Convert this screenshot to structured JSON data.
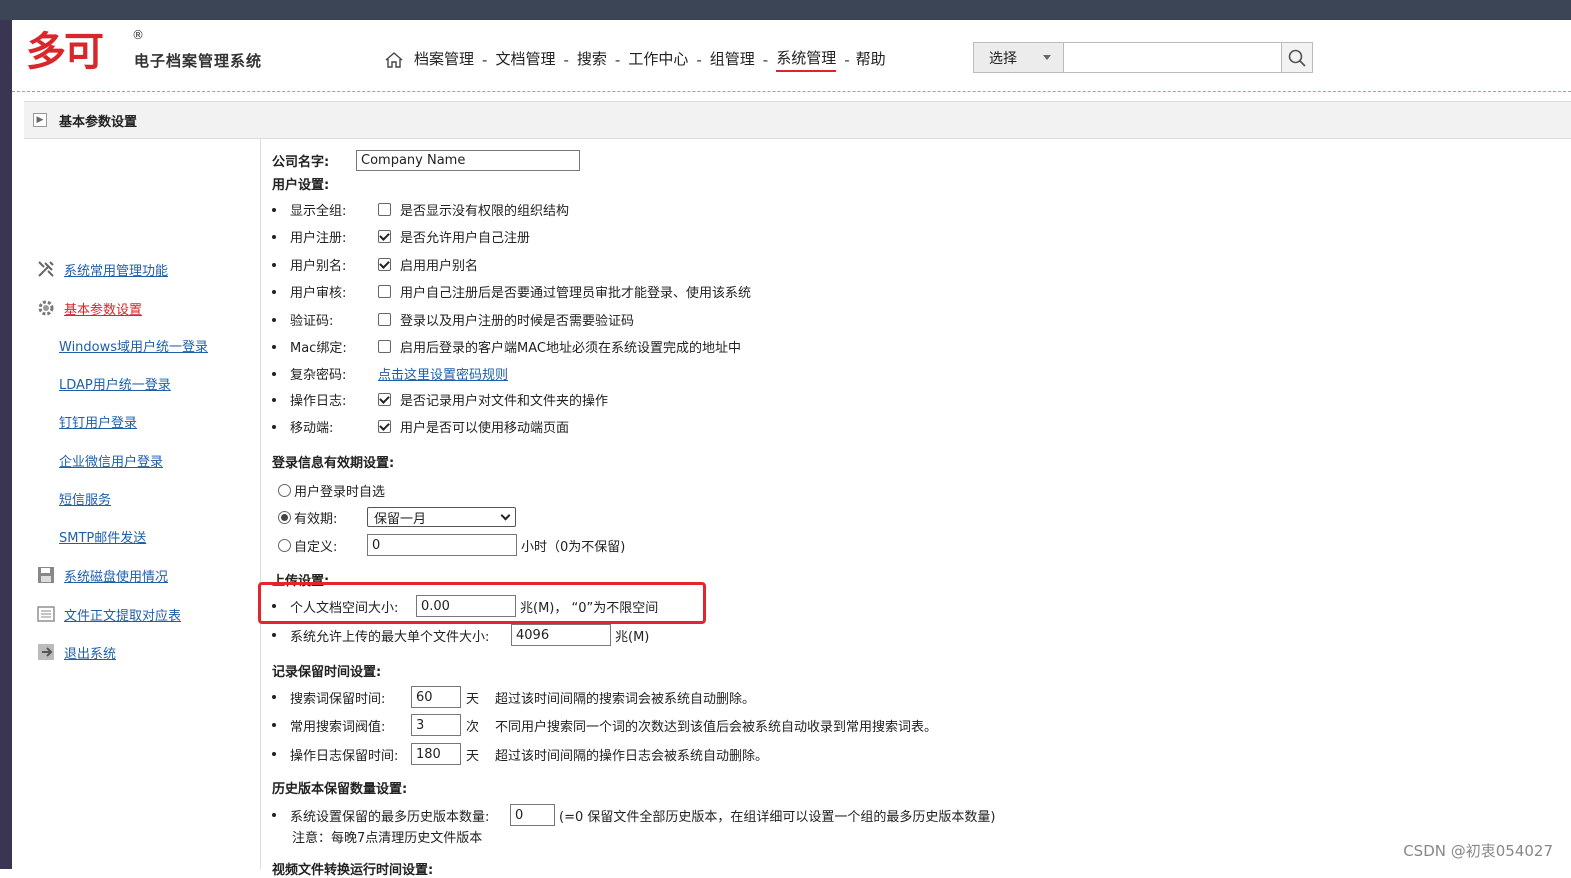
{
  "header": {
    "logo_text": "多可",
    "logo_sub": "电子档案管理系统",
    "reg_mark": "®"
  },
  "nav": {
    "items": [
      {
        "label": "档案管理"
      },
      {
        "label": "文档管理"
      },
      {
        "label": "搜索"
      },
      {
        "label": "工作中心"
      },
      {
        "label": "组管理"
      },
      {
        "label": "系统管理",
        "active": true
      },
      {
        "label": "帮助"
      }
    ],
    "sep": "-"
  },
  "search": {
    "select_label": "选择",
    "placeholder": ""
  },
  "title": "基本参数设置",
  "sidebar": {
    "items": [
      {
        "label": "系统常用管理功能",
        "icon": "tools-icon"
      },
      {
        "label": "基本参数设置",
        "icon": "gear-icon",
        "active": true
      },
      {
        "label": "Windows域用户统一登录"
      },
      {
        "label": "LDAP用户统一登录"
      },
      {
        "label": "钉钉用户登录"
      },
      {
        "label": "企业微信用户登录"
      },
      {
        "label": "短信服务"
      },
      {
        "label": "SMTP邮件发送"
      },
      {
        "label": "系统磁盘使用情况",
        "icon": "disk-icon"
      },
      {
        "label": "文件正文提取对应表",
        "icon": "list-icon"
      },
      {
        "label": "退出系统",
        "icon": "exit-icon"
      }
    ]
  },
  "form": {
    "company_label": "公司名字:",
    "company_value": "Company Name",
    "user_settings": "用户设置:",
    "user_rows": [
      {
        "label": "显示全组:",
        "checked": false,
        "text": "是否显示没有权限的组织结构"
      },
      {
        "label": "用户注册:",
        "checked": true,
        "text": "是否允许用户自己注册"
      },
      {
        "label": "用户别名:",
        "checked": true,
        "text": "启用用户别名"
      },
      {
        "label": "用户审核:",
        "checked": false,
        "text": "用户自己注册后是否要通过管理员审批才能登录、使用该系统"
      },
      {
        "label": "验证码:",
        "checked": false,
        "text": "登录以及用户注册的时候是否需要验证码"
      },
      {
        "label": "Mac绑定:",
        "checked": false,
        "text": "启用后登录的客户端MAC地址必须在系统设置完成的地址中"
      },
      {
        "label": "复杂密码:",
        "link": "点击这里设置密码规则"
      },
      {
        "label": "操作日志:",
        "checked": true,
        "text": "是否记录用户对文件和文件夹的操作"
      },
      {
        "label": "移动端:",
        "checked": true,
        "text": "用户是否可以使用移动端页面"
      }
    ],
    "login_section": "登录信息有效期设置:",
    "login_opt1": "用户登录时自选",
    "login_opt2": "有效期:",
    "login_opt2_value": "保留一月",
    "login_opt3": "自定义:",
    "login_opt3_value": "0",
    "login_opt3_unit": "小时（0为不保留)",
    "upload_section": "上传设置:",
    "upload_personal_label": "个人文档空间大小:",
    "upload_personal_value": "0.00",
    "upload_personal_unit": "兆(M)，  “0”为不限空间",
    "upload_max_label": "系统允许上传的最大单个文件大小:",
    "upload_max_value": "4096",
    "upload_max_unit": "兆(M)",
    "record_section": "记录保留时间设置:",
    "record_rows": [
      {
        "label": "搜索词保留时间:",
        "value": "60",
        "unit": "天",
        "desc": "超过该时间间隔的搜索词会被系统自动删除。"
      },
      {
        "label": "常用搜索词阀值:",
        "value": "3",
        "unit": "次",
        "desc": "不同用户搜索同一个词的次数达到该值后会被系统自动收录到常用搜索词表。"
      },
      {
        "label": "操作日志保留时间:",
        "value": "180",
        "unit": "天",
        "desc": "超过该时间间隔的操作日志会被系统自动删除。"
      }
    ],
    "history_section": "历史版本保留数量设置:",
    "history_label": "系统设置保留的最多历史版本数量:",
    "history_value": "0",
    "history_desc": "(=0 保留文件全部历史版本，在组详细可以设置一个组的最多历史版本数量)",
    "history_note": "注意：每晚7点清理历史文件版本",
    "video_section": "视频文件转换运行时间设置:"
  },
  "watermark": "CSDN @初衷054027",
  "colors": {
    "accent_red": "#d8262b",
    "link": "#1f5fa8",
    "highlight_box": "#e3252d"
  }
}
